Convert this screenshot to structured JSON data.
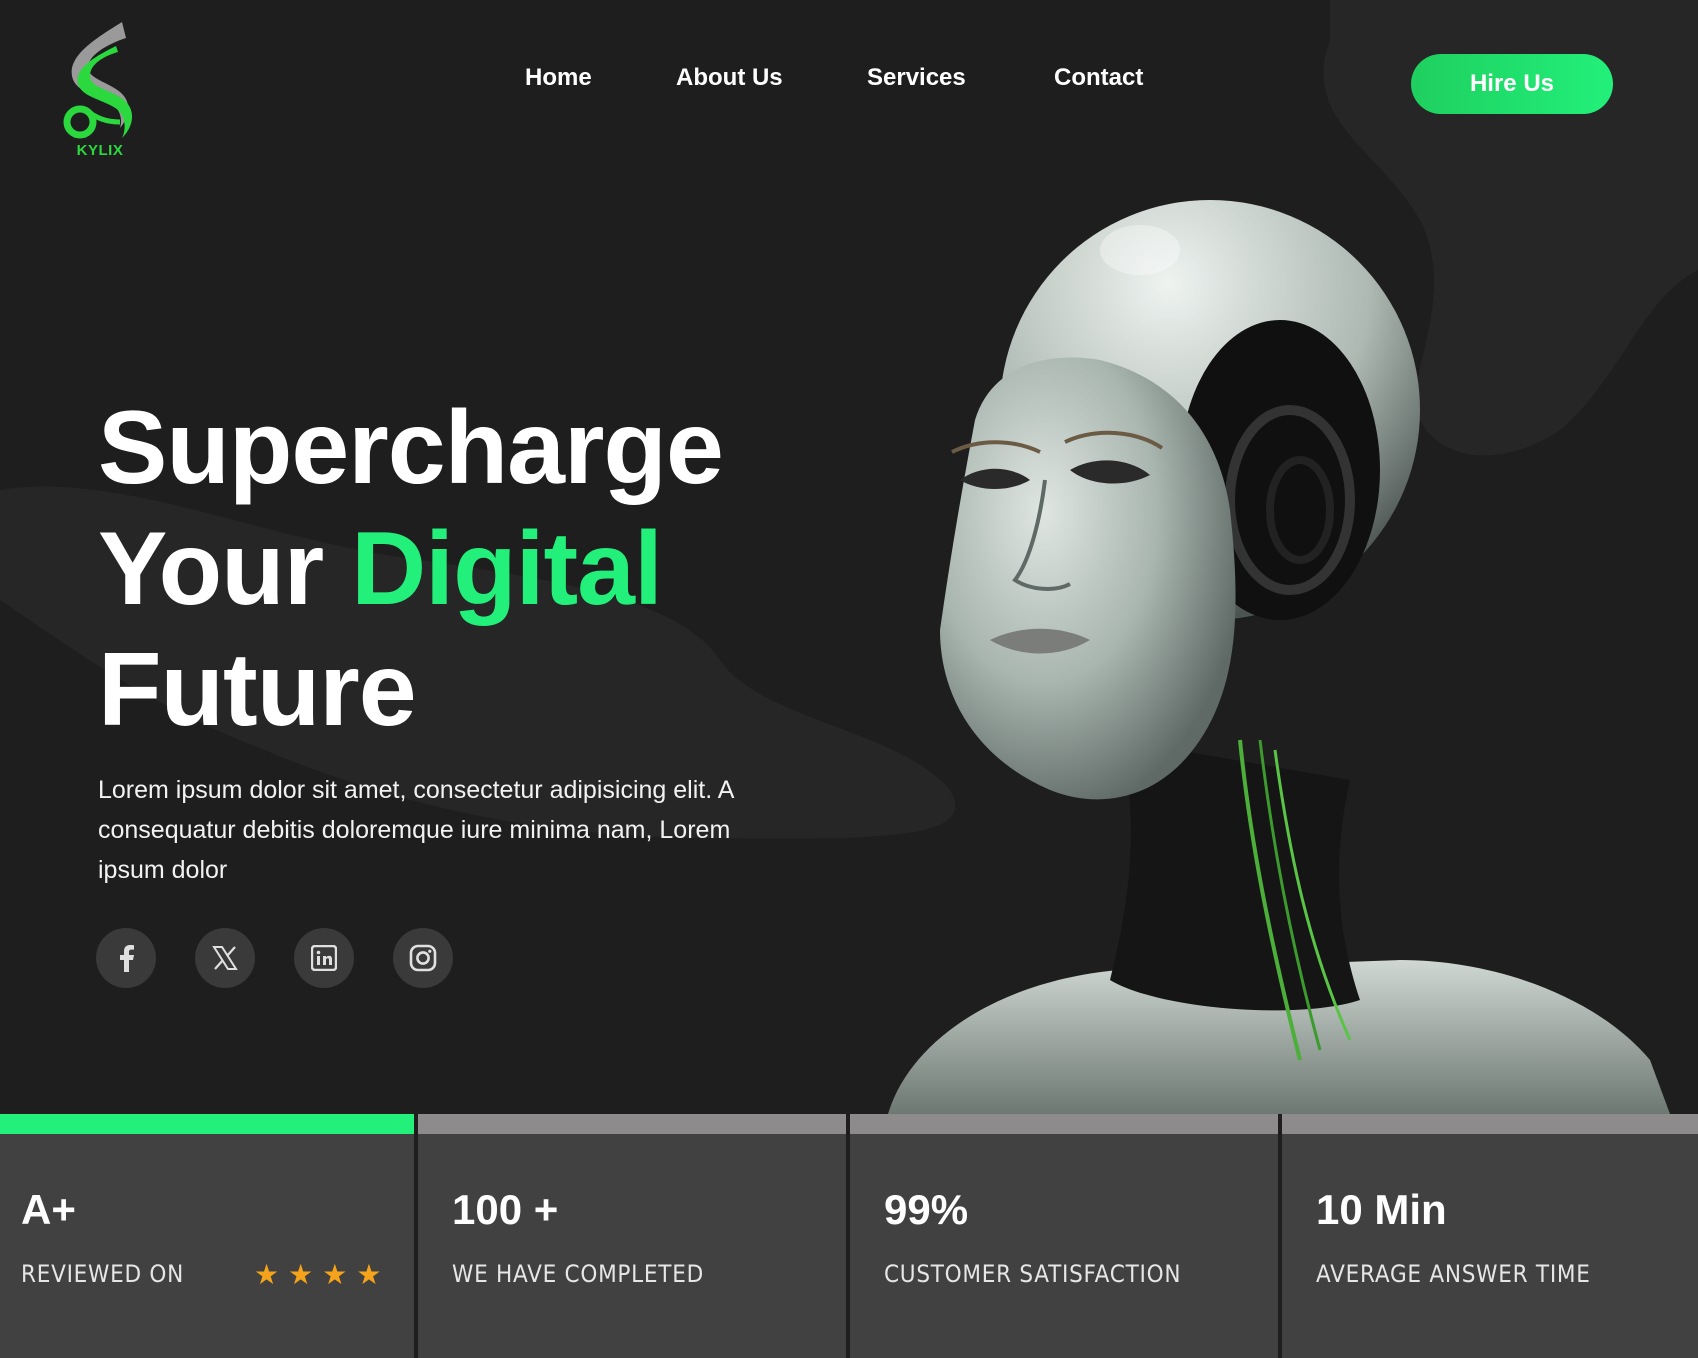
{
  "brand": {
    "name": "KYLIX",
    "accent_color": "#22f07a",
    "logo_icon": "kylix-swirl-logo-icon"
  },
  "nav": {
    "items": [
      {
        "label": "Home"
      },
      {
        "label": "About Us"
      },
      {
        "label": "Services"
      },
      {
        "label": "Contact"
      }
    ],
    "cta_label": "Hire Us"
  },
  "hero": {
    "title_line1": "Supercharge",
    "title_line2_plain": "Your ",
    "title_line2_accent": "Digital",
    "title_line3": "Future",
    "description": "Lorem ipsum dolor sit amet, consectetur adipisicing elit. A consequatur debitis doloremque iure minima nam, Lorem ipsum dolor",
    "image_icon": "robot-head-illustration"
  },
  "socials": [
    {
      "icon": "facebook-icon"
    },
    {
      "icon": "x-twitter-icon"
    },
    {
      "icon": "linkedin-icon"
    },
    {
      "icon": "instagram-icon"
    }
  ],
  "stats": [
    {
      "value": "A+",
      "label": "REVIEWED ON",
      "stars": 4,
      "active": true
    },
    {
      "value": "100 +",
      "label": "WE HAVE COMPLETED",
      "active": false
    },
    {
      "value": "99%",
      "label": "CUSTOMER SATISFACTION",
      "active": false
    },
    {
      "value": "10 Min",
      "label": "AVERAGE ANSWER TIME",
      "active": false
    }
  ],
  "colors": {
    "background": "#1e1e1e",
    "stat_card": "#414141",
    "stat_bar_inactive": "#8d8b8b",
    "star": "#f5a31a"
  }
}
